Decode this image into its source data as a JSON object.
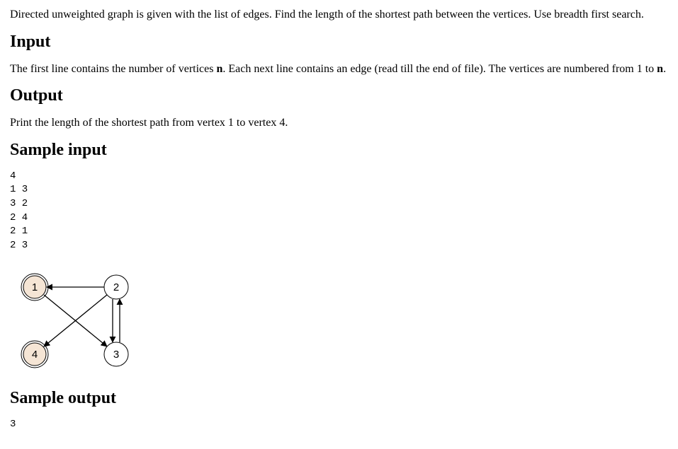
{
  "intro": {
    "prefix": "Directed unweighted graph is given with the list of edges. Find the length of the shortest path between the vertices. Use breadth first search."
  },
  "input_heading": "Input",
  "input_text_prefix": "The first line contains the number of vertices ",
  "input_n1": "n",
  "input_text_middle": ". Each next line contains an edge (read till the end of file). The vertices are numbered from 1 to ",
  "input_n2": "n",
  "input_text_suffix": ".",
  "output_heading": "Output",
  "output_text": "Print the length of the shortest path from vertex 1 to vertex 4.",
  "sample_input_heading": "Sample input",
  "sample_input": "4\n1 3\n3 2\n2 4\n2 1\n2 3",
  "graph": {
    "nodes": {
      "n1": "1",
      "n2": "2",
      "n3": "3",
      "n4": "4"
    }
  },
  "sample_output_heading": "Sample output",
  "sample_output": "3"
}
